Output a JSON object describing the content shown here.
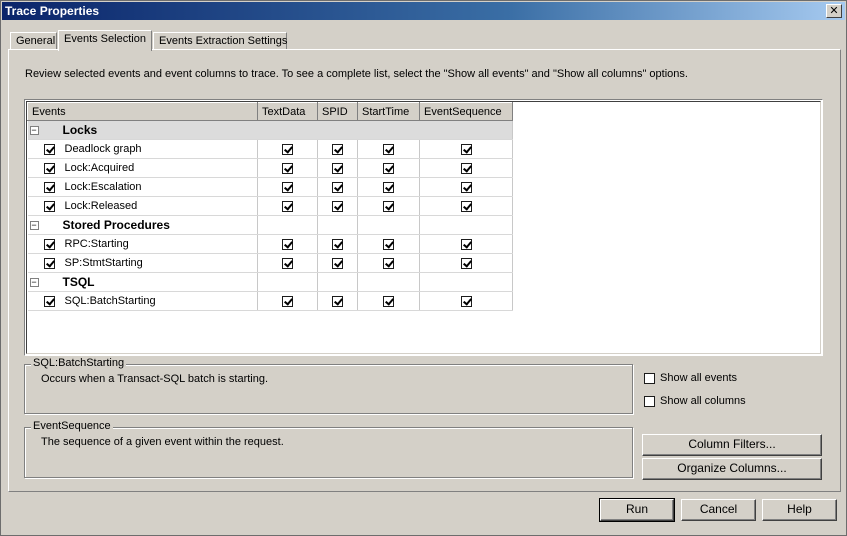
{
  "window": {
    "title": "Trace Properties",
    "close_label": "✕"
  },
  "tabs": [
    {
      "label": "General",
      "active": false
    },
    {
      "label": "Events Selection",
      "active": true
    },
    {
      "label": "Events Extraction Settings",
      "active": false
    }
  ],
  "instruction": "Review selected events and event columns to trace. To see a complete list, select the \"Show all events\" and \"Show all columns\" options.",
  "grid": {
    "columns": [
      "Events",
      "TextData",
      "SPID",
      "StartTime",
      "EventSequence"
    ],
    "groups": [
      {
        "name": "Locks",
        "toggle": "−",
        "events": [
          {
            "name": "Deadlock graph",
            "checked": true,
            "cols": [
              true,
              true,
              true,
              true
            ]
          },
          {
            "name": "Lock:Acquired",
            "checked": true,
            "cols": [
              true,
              true,
              true,
              true
            ]
          },
          {
            "name": "Lock:Escalation",
            "checked": true,
            "cols": [
              true,
              true,
              true,
              true
            ]
          },
          {
            "name": "Lock:Released",
            "checked": true,
            "cols": [
              true,
              true,
              true,
              true
            ]
          }
        ]
      },
      {
        "name": "Stored Procedures",
        "toggle": "−",
        "events": [
          {
            "name": "RPC:Starting",
            "checked": true,
            "cols": [
              true,
              true,
              true,
              true
            ]
          },
          {
            "name": "SP:StmtStarting",
            "checked": true,
            "cols": [
              true,
              true,
              true,
              true
            ]
          }
        ]
      },
      {
        "name": "TSQL",
        "toggle": "−",
        "events": [
          {
            "name": "SQL:BatchStarting",
            "checked": true,
            "cols": [
              true,
              true,
              true,
              true
            ]
          }
        ]
      }
    ]
  },
  "event_desc": {
    "title": "SQL:BatchStarting",
    "text": "Occurs when a Transact-SQL batch is starting."
  },
  "column_desc": {
    "title": "EventSequence",
    "text": "The sequence of a given event within the request."
  },
  "options": {
    "show_all_events": "Show all events",
    "show_all_columns": "Show all columns"
  },
  "buttons": {
    "column_filters": "Column Filters...",
    "organize_columns": "Organize Columns...",
    "run": "Run",
    "cancel": "Cancel",
    "help": "Help"
  }
}
